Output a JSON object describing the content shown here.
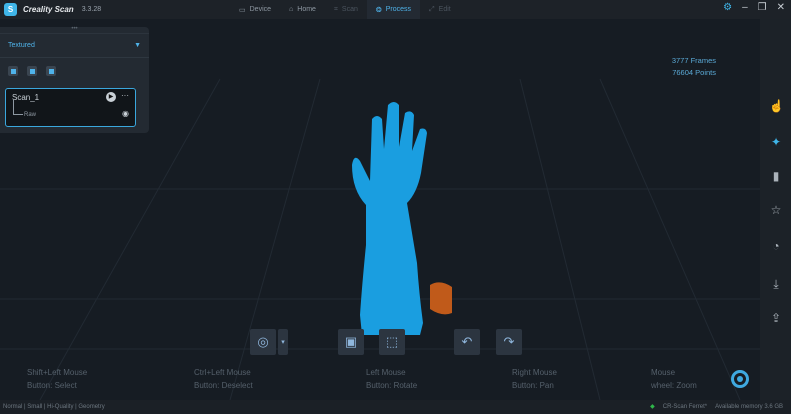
{
  "app": {
    "name": "Creality Scan",
    "version": "3.3.28"
  },
  "tabs": [
    {
      "label": "Device"
    },
    {
      "label": "Home"
    },
    {
      "label": "Scan"
    },
    {
      "label": "Process"
    },
    {
      "label": "Edit"
    }
  ],
  "panel": {
    "dropdown": "Textured",
    "scan_name": "Scan_1",
    "child": "Raw"
  },
  "stats": {
    "frames": "3777  Frames",
    "points": "76604  Points"
  },
  "hints": [
    {
      "l1": "Shift+Left Mouse",
      "l2": "Button:  Select"
    },
    {
      "l1": "Ctrl+Left Mouse",
      "l2": "Button:  Deselect"
    },
    {
      "l1": "Left Mouse",
      "l2": "Button:  Rotate"
    },
    {
      "l1": "Right Mouse",
      "l2": "Button:  Pan"
    },
    {
      "l1": "Mouse",
      "l2": "wheel:  Zoom"
    }
  ],
  "status": {
    "left": "Normal | Small | Hi-Quality | Geometry",
    "device": "CR-Scan Ferret*",
    "memory": "Available memory   3.6 GB"
  },
  "colors": {
    "accent": "#3fb5e8",
    "model": "#1a9ee0",
    "model_dark": "#c05a1a"
  }
}
